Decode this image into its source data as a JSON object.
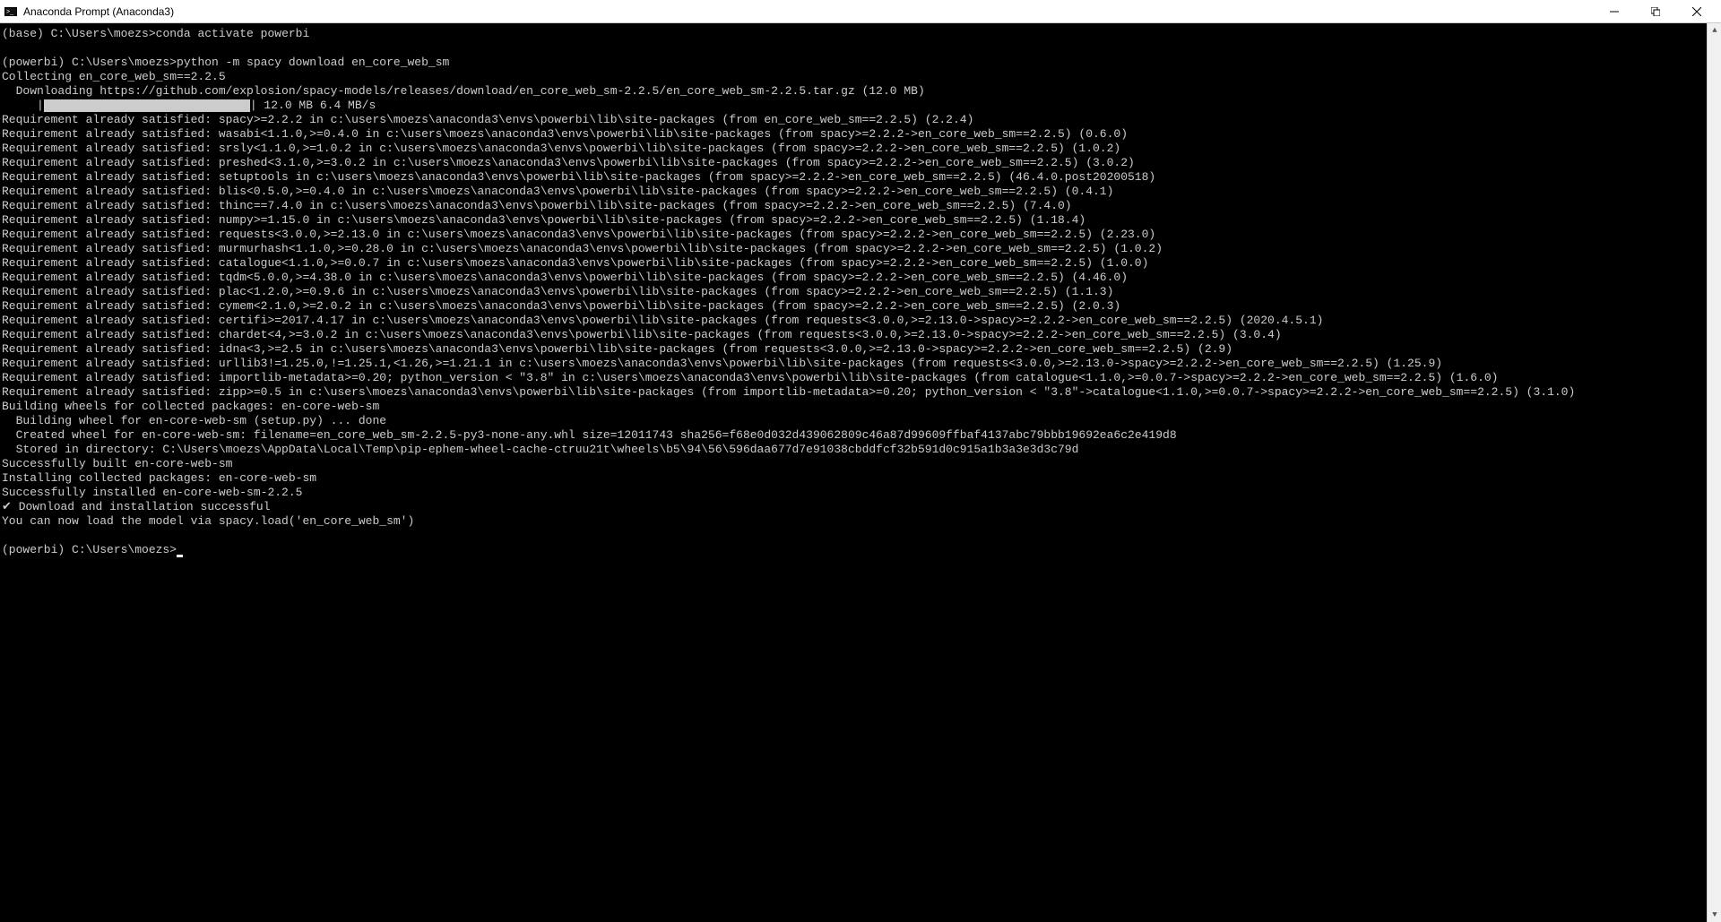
{
  "window": {
    "title": "Anaconda Prompt (Anaconda3)"
  },
  "terminal": {
    "prompt1": "(base) C:\\Users\\moezs>",
    "cmd1": "conda activate powerbi",
    "prompt2": "(powerbi) C:\\Users\\moezs>",
    "cmd2": "python -m spacy download en_core_web_sm",
    "collecting": "Collecting en_core_web_sm==2.2.5",
    "downloading": "  Downloading https://github.com/explosion/spacy-models/releases/download/en_core_web_sm-2.2.5/en_core_web_sm-2.2.5.tar.gz (12.0 MB)",
    "progress_prefix": "     |",
    "progress_suffix": "| 12.0 MB 6.4 MB/s",
    "requirements": [
      "Requirement already satisfied: spacy>=2.2.2 in c:\\users\\moezs\\anaconda3\\envs\\powerbi\\lib\\site-packages (from en_core_web_sm==2.2.5) (2.2.4)",
      "Requirement already satisfied: wasabi<1.1.0,>=0.4.0 in c:\\users\\moezs\\anaconda3\\envs\\powerbi\\lib\\site-packages (from spacy>=2.2.2->en_core_web_sm==2.2.5) (0.6.0)",
      "Requirement already satisfied: srsly<1.1.0,>=1.0.2 in c:\\users\\moezs\\anaconda3\\envs\\powerbi\\lib\\site-packages (from spacy>=2.2.2->en_core_web_sm==2.2.5) (1.0.2)",
      "Requirement already satisfied: preshed<3.1.0,>=3.0.2 in c:\\users\\moezs\\anaconda3\\envs\\powerbi\\lib\\site-packages (from spacy>=2.2.2->en_core_web_sm==2.2.5) (3.0.2)",
      "Requirement already satisfied: setuptools in c:\\users\\moezs\\anaconda3\\envs\\powerbi\\lib\\site-packages (from spacy>=2.2.2->en_core_web_sm==2.2.5) (46.4.0.post20200518)",
      "Requirement already satisfied: blis<0.5.0,>=0.4.0 in c:\\users\\moezs\\anaconda3\\envs\\powerbi\\lib\\site-packages (from spacy>=2.2.2->en_core_web_sm==2.2.5) (0.4.1)",
      "Requirement already satisfied: thinc==7.4.0 in c:\\users\\moezs\\anaconda3\\envs\\powerbi\\lib\\site-packages (from spacy>=2.2.2->en_core_web_sm==2.2.5) (7.4.0)",
      "Requirement already satisfied: numpy>=1.15.0 in c:\\users\\moezs\\anaconda3\\envs\\powerbi\\lib\\site-packages (from spacy>=2.2.2->en_core_web_sm==2.2.5) (1.18.4)",
      "Requirement already satisfied: requests<3.0.0,>=2.13.0 in c:\\users\\moezs\\anaconda3\\envs\\powerbi\\lib\\site-packages (from spacy>=2.2.2->en_core_web_sm==2.2.5) (2.23.0)",
      "Requirement already satisfied: murmurhash<1.1.0,>=0.28.0 in c:\\users\\moezs\\anaconda3\\envs\\powerbi\\lib\\site-packages (from spacy>=2.2.2->en_core_web_sm==2.2.5) (1.0.2)",
      "Requirement already satisfied: catalogue<1.1.0,>=0.0.7 in c:\\users\\moezs\\anaconda3\\envs\\powerbi\\lib\\site-packages (from spacy>=2.2.2->en_core_web_sm==2.2.5) (1.0.0)",
      "Requirement already satisfied: tqdm<5.0.0,>=4.38.0 in c:\\users\\moezs\\anaconda3\\envs\\powerbi\\lib\\site-packages (from spacy>=2.2.2->en_core_web_sm==2.2.5) (4.46.0)",
      "Requirement already satisfied: plac<1.2.0,>=0.9.6 in c:\\users\\moezs\\anaconda3\\envs\\powerbi\\lib\\site-packages (from spacy>=2.2.2->en_core_web_sm==2.2.5) (1.1.3)",
      "Requirement already satisfied: cymem<2.1.0,>=2.0.2 in c:\\users\\moezs\\anaconda3\\envs\\powerbi\\lib\\site-packages (from spacy>=2.2.2->en_core_web_sm==2.2.5) (2.0.3)",
      "Requirement already satisfied: certifi>=2017.4.17 in c:\\users\\moezs\\anaconda3\\envs\\powerbi\\lib\\site-packages (from requests<3.0.0,>=2.13.0->spacy>=2.2.2->en_core_web_sm==2.2.5) (2020.4.5.1)",
      "Requirement already satisfied: chardet<4,>=3.0.2 in c:\\users\\moezs\\anaconda3\\envs\\powerbi\\lib\\site-packages (from requests<3.0.0,>=2.13.0->spacy>=2.2.2->en_core_web_sm==2.2.5) (3.0.4)",
      "Requirement already satisfied: idna<3,>=2.5 in c:\\users\\moezs\\anaconda3\\envs\\powerbi\\lib\\site-packages (from requests<3.0.0,>=2.13.0->spacy>=2.2.2->en_core_web_sm==2.2.5) (2.9)",
      "Requirement already satisfied: urllib3!=1.25.0,!=1.25.1,<1.26,>=1.21.1 in c:\\users\\moezs\\anaconda3\\envs\\powerbi\\lib\\site-packages (from requests<3.0.0,>=2.13.0->spacy>=2.2.2->en_core_web_sm==2.2.5) (1.25.9)",
      "Requirement already satisfied: importlib-metadata>=0.20; python_version < \"3.8\" in c:\\users\\moezs\\anaconda3\\envs\\powerbi\\lib\\site-packages (from catalogue<1.1.0,>=0.0.7->spacy>=2.2.2->en_core_web_sm==2.2.5) (1.6.0)",
      "Requirement already satisfied: zipp>=0.5 in c:\\users\\moezs\\anaconda3\\envs\\powerbi\\lib\\site-packages (from importlib-metadata>=0.20; python_version < \"3.8\"->catalogue<1.1.0,>=0.0.7->spacy>=2.2.2->en_core_web_sm==2.2.5) (3.1.0)"
    ],
    "building_header": "Building wheels for collected packages: en-core-web-sm",
    "building_wheel": "  Building wheel for en-core-web-sm (setup.py) ... done",
    "created_wheel": "  Created wheel for en-core-web-sm: filename=en_core_web_sm-2.2.5-py3-none-any.whl size=12011743 sha256=f68e0d032d439062809c46a87d99609ffbaf4137abc79bbb19692ea6c2e419d8",
    "stored_dir": "  Stored in directory: C:\\Users\\moezs\\AppData\\Local\\Temp\\pip-ephem-wheel-cache-ctruu21t\\wheels\\b5\\94\\56\\596daa677d7e91038cbddfcf32b591d0c915a1b3a3e3d3c79d",
    "built_success": "Successfully built en-core-web-sm",
    "installing": "Installing collected packages: en-core-web-sm",
    "installed_success": "Successfully installed en-core-web-sm-2.2.5",
    "download_success": "✔ Download and installation successful",
    "load_hint": "You can now load the model via spacy.load('en_core_web_sm')",
    "prompt3": "(powerbi) C:\\Users\\moezs>"
  }
}
